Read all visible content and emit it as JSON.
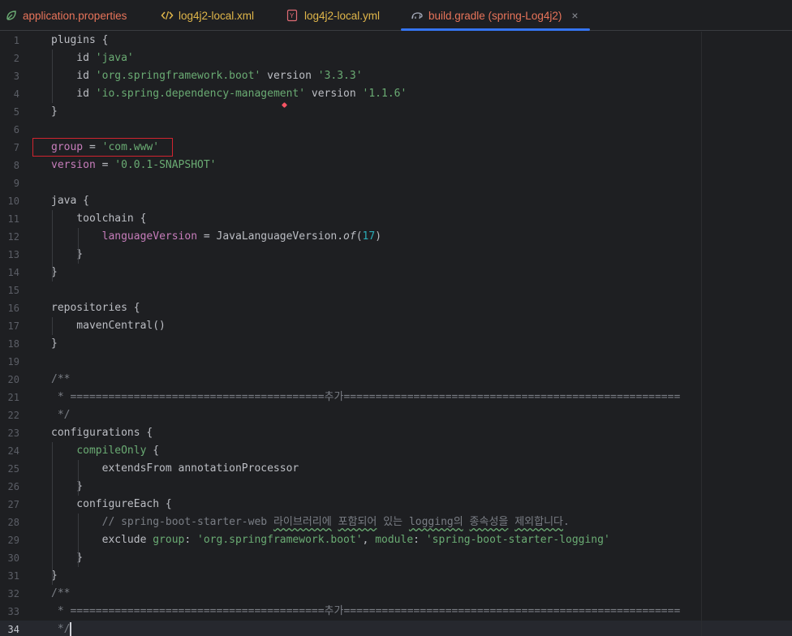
{
  "tabs": [
    {
      "label": "application.properties",
      "icon": "spring-leaf-icon",
      "color": "#e8745a",
      "active": false
    },
    {
      "label": "log4j2-local.xml",
      "icon": "xml-code-icon",
      "color": "#e0b64a",
      "active": false
    },
    {
      "label": "log4j2-local.yml",
      "icon": "yaml-icon",
      "color": "#e0b64a",
      "active": false
    },
    {
      "label": "build.gradle (spring-Log4j2)",
      "icon": "gradle-elephant-icon",
      "color": "#e8745a",
      "active": true,
      "close": "×"
    }
  ],
  "colors": {
    "background": "#1e1f22",
    "accent": "#3574f0",
    "string": "#6aab73",
    "property": "#c77dbb",
    "number": "#2aacb8",
    "comment": "#7a7e85",
    "highlight_box": "#d1242f"
  },
  "editor": {
    "current_line": 34,
    "lines": [
      {
        "n": "1",
        "t": [
          [
            "plugins {",
            "kw"
          ]
        ]
      },
      {
        "n": "2",
        "t": [
          [
            "    id ",
            "kw"
          ],
          [
            "'java'",
            "str"
          ]
        ]
      },
      {
        "n": "3",
        "t": [
          [
            "    id ",
            "kw"
          ],
          [
            "'org.springframework.boot'",
            "str"
          ],
          [
            " version ",
            "kw"
          ],
          [
            "'3.3.3'",
            "str"
          ]
        ]
      },
      {
        "n": "4",
        "t": [
          [
            "    id ",
            "kw"
          ],
          [
            "'io.spring.dependency-management'",
            "str"
          ],
          [
            " version ",
            "kw"
          ],
          [
            "'1.1.6'",
            "str"
          ]
        ]
      },
      {
        "n": "5",
        "t": [
          [
            "}",
            "kw"
          ]
        ]
      },
      {
        "n": "6",
        "t": []
      },
      {
        "n": "7",
        "t": [
          [
            "group",
            "prop"
          ],
          [
            " = ",
            "kw"
          ],
          [
            "'com.www'",
            "str"
          ]
        ]
      },
      {
        "n": "8",
        "t": [
          [
            "version",
            "prop"
          ],
          [
            " = ",
            "kw"
          ],
          [
            "'0.0.1-SNAPSHOT'",
            "str"
          ]
        ]
      },
      {
        "n": "9",
        "t": []
      },
      {
        "n": "10",
        "t": [
          [
            "java {",
            "kw"
          ]
        ]
      },
      {
        "n": "11",
        "t": [
          [
            "    toolchain {",
            "kw"
          ]
        ]
      },
      {
        "n": "12",
        "t": [
          [
            "        ",
            "kw"
          ],
          [
            "languageVersion",
            "prop"
          ],
          [
            " = JavaLanguageVersion.",
            "kw"
          ],
          [
            "of",
            "ital"
          ],
          [
            "(",
            "kw"
          ],
          [
            "17",
            "num"
          ],
          [
            ")",
            "kw"
          ]
        ]
      },
      {
        "n": "13",
        "t": [
          [
            "    }",
            "kw"
          ]
        ]
      },
      {
        "n": "14",
        "t": [
          [
            "}",
            "kw"
          ]
        ]
      },
      {
        "n": "15",
        "t": []
      },
      {
        "n": "16",
        "t": [
          [
            "repositories {",
            "kw"
          ]
        ]
      },
      {
        "n": "17",
        "t": [
          [
            "    mavenCentral()",
            "kw"
          ]
        ]
      },
      {
        "n": "18",
        "t": [
          [
            "}",
            "kw"
          ]
        ]
      },
      {
        "n": "19",
        "t": []
      },
      {
        "n": "20",
        "t": [
          [
            "/**",
            "cmt"
          ]
        ]
      },
      {
        "n": "21",
        "t": [
          [
            " * ========================================추가=====================================================",
            "cmt"
          ]
        ]
      },
      {
        "n": "22",
        "t": [
          [
            " */",
            "cmt"
          ]
        ]
      },
      {
        "n": "23",
        "t": [
          [
            "configurations {",
            "kw"
          ]
        ]
      },
      {
        "n": "24",
        "t": [
          [
            "    ",
            "kw"
          ],
          [
            "compileOnly",
            "grn"
          ],
          [
            " {",
            "kw"
          ]
        ]
      },
      {
        "n": "25",
        "t": [
          [
            "        extendsFrom annotationProcessor",
            "kw"
          ]
        ]
      },
      {
        "n": "26",
        "t": [
          [
            "    }",
            "kw"
          ]
        ]
      },
      {
        "n": "27",
        "t": [
          [
            "    configureEach {",
            "kw"
          ]
        ]
      },
      {
        "n": "28",
        "t": [
          [
            "        // spring-boot-starter-web ",
            "cmt"
          ],
          [
            "라이브러리에",
            "cmt wavy"
          ],
          [
            " ",
            "cmt"
          ],
          [
            "포함되어",
            "cmt wavy"
          ],
          [
            " 있는 ",
            "cmt"
          ],
          [
            "logging의",
            "cmt wavy"
          ],
          [
            " ",
            "cmt"
          ],
          [
            "종속성을",
            "cmt wavy"
          ],
          [
            " ",
            "cmt"
          ],
          [
            "제외합니다",
            "cmt wavy"
          ],
          [
            ".",
            "cmt"
          ]
        ]
      },
      {
        "n": "29",
        "t": [
          [
            "        exclude ",
            "kw"
          ],
          [
            "group",
            "grn"
          ],
          [
            ": ",
            "kw"
          ],
          [
            "'org.springframework.boot'",
            "str"
          ],
          [
            ", ",
            "kw"
          ],
          [
            "module",
            "grn"
          ],
          [
            ": ",
            "kw"
          ],
          [
            "'spring-boot-starter-logging'",
            "str"
          ]
        ]
      },
      {
        "n": "30",
        "t": [
          [
            "    }",
            "kw"
          ]
        ]
      },
      {
        "n": "31",
        "t": [
          [
            "}",
            "kw"
          ]
        ]
      },
      {
        "n": "32",
        "t": [
          [
            "/**",
            "cmt"
          ]
        ]
      },
      {
        "n": "33",
        "t": [
          [
            " * ========================================추가=====================================================",
            "cmt"
          ]
        ]
      },
      {
        "n": "34",
        "t": [
          [
            " */",
            "cmt"
          ]
        ]
      }
    ]
  }
}
